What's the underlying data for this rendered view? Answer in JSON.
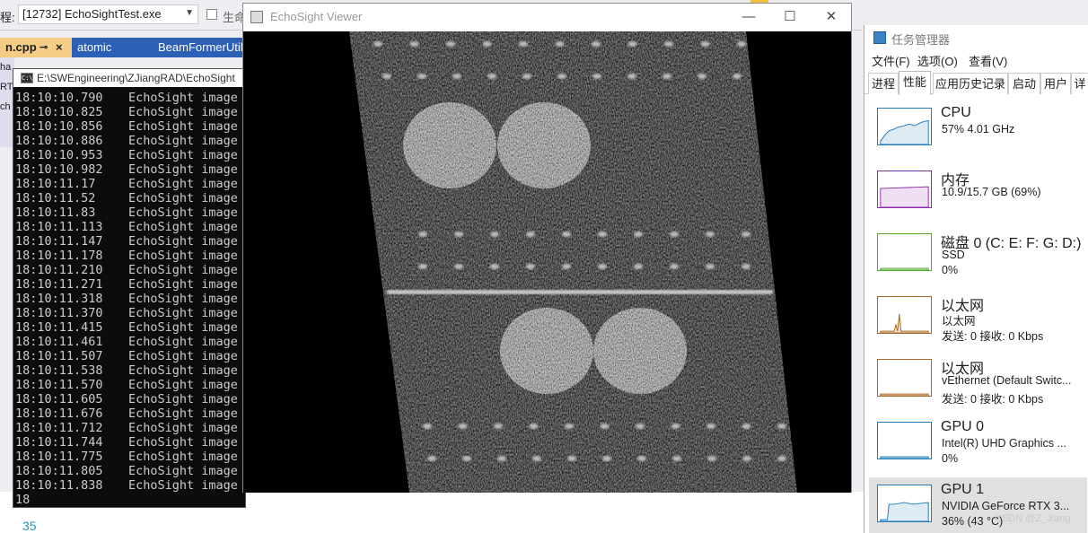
{
  "vs": {
    "process_label": "程:",
    "process_value": "[12732] EchoSightTest.exe",
    "gen_label": "生命",
    "tabs": [
      {
        "label": "n.cpp",
        "pin": "⊸",
        "close": "×"
      },
      {
        "label": "atomic"
      },
      {
        "label": "BeamFormerUtil"
      }
    ],
    "side_labels": [
      "ha",
      "RT",
      "ch"
    ],
    "line_number": "35"
  },
  "console": {
    "title": "E:\\SWEngineering\\ZJiangRAD\\EchoSight",
    "icon_label": "C:\\",
    "lines": [
      {
        "ts": "18:10:10.790",
        "msg": "EchoSight image"
      },
      {
        "ts": "18:10:10.825",
        "msg": "EchoSight image"
      },
      {
        "ts": "18:10:10.856",
        "msg": "EchoSight image"
      },
      {
        "ts": "18:10:10.886",
        "msg": "EchoSight image"
      },
      {
        "ts": "18:10:10.953",
        "msg": "EchoSight image"
      },
      {
        "ts": "18:10:10.982",
        "msg": "EchoSight image"
      },
      {
        "ts": "18:10:11.17",
        "msg": "EchoSight image"
      },
      {
        "ts": "18:10:11.52",
        "msg": "EchoSight image"
      },
      {
        "ts": "18:10:11.83",
        "msg": "EchoSight image"
      },
      {
        "ts": "18:10:11.113",
        "msg": "EchoSight image"
      },
      {
        "ts": "18:10:11.147",
        "msg": "EchoSight image"
      },
      {
        "ts": "18:10:11.178",
        "msg": "EchoSight image"
      },
      {
        "ts": "18:10:11.210",
        "msg": "EchoSight image"
      },
      {
        "ts": "18:10:11.271",
        "msg": "EchoSight image"
      },
      {
        "ts": "18:10:11.318",
        "msg": "EchoSight image"
      },
      {
        "ts": "18:10:11.370",
        "msg": "EchoSight image"
      },
      {
        "ts": "18:10:11.415",
        "msg": "EchoSight image"
      },
      {
        "ts": "18:10:11.461",
        "msg": "EchoSight image"
      },
      {
        "ts": "18:10:11.507",
        "msg": "EchoSight image"
      },
      {
        "ts": "18:10:11.538",
        "msg": "EchoSight image"
      },
      {
        "ts": "18:10:11.570",
        "msg": "EchoSight image"
      },
      {
        "ts": "18:10:11.605",
        "msg": "EchoSight image"
      },
      {
        "ts": "18:10:11.676",
        "msg": "EchoSight image"
      },
      {
        "ts": "18:10:11.712",
        "msg": "EchoSight image"
      },
      {
        "ts": "18:10:11.744",
        "msg": "EchoSight image"
      },
      {
        "ts": "18:10:11.775",
        "msg": "EchoSight image"
      },
      {
        "ts": "18:10:11.805",
        "msg": "EchoSight image"
      },
      {
        "ts": "18:10:11.838",
        "msg": "EchoSight image"
      },
      {
        "ts": "18",
        "msg": ""
      }
    ]
  },
  "viewer": {
    "title": "EchoSight Viewer",
    "min_glyph": "—",
    "max_glyph": "☐",
    "close_glyph": "✕"
  },
  "taskmgr": {
    "title": "任务管理器",
    "menu": [
      "文件(F)",
      "选项(O)",
      "查看(V)"
    ],
    "tabs": [
      "进程",
      "性能",
      "应用历史记录",
      "启动",
      "用户",
      "详"
    ],
    "active_tab": "性能",
    "items": [
      {
        "name": "CPU",
        "sub1": "57% 4.01 GHz",
        "sub2": "",
        "color": "#1f7ab8"
      },
      {
        "name": "内存",
        "sub1": "10.9/15.7 GB (69%)",
        "sub2": "",
        "color": "#8b2fa8"
      },
      {
        "name": "磁盘 0 (C: E: F: G: D:)",
        "sub1": "SSD",
        "sub2": "0%",
        "color": "#4fa82a"
      },
      {
        "name": "以太网",
        "sub1": "以太网",
        "sub2": "发送: 0 接收: 0 Kbps",
        "color": "#a8651e"
      },
      {
        "name": "以太网",
        "sub1": "vEthernet (Default Switc...",
        "sub2": "发送: 0 接收: 0 Kbps",
        "color": "#a8651e"
      },
      {
        "name": "GPU 0",
        "sub1": "Intel(R) UHD Graphics ...",
        "sub2": "0%",
        "color": "#1f7ab8"
      },
      {
        "name": "GPU 1",
        "sub1": "NVIDIA GeForce RTX 3...",
        "sub2": "36% (43 °C)",
        "color": "#1f7ab8"
      }
    ],
    "selected_item": "GPU 1",
    "watermark": "CSDN @Z_Jiang"
  }
}
